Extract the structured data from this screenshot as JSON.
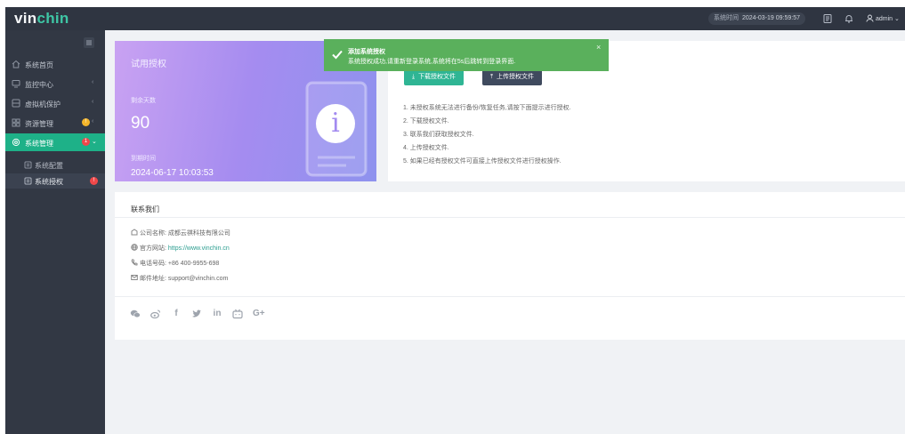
{
  "app": {
    "logo_prefix": "vin",
    "logo_suffix": "chin",
    "system_time_label": "系统时间",
    "system_time_value": "2024-03-19 09:59:57",
    "user_name": "admin"
  },
  "colors": {
    "topbar": "#2f3541",
    "sidebar": "#323844",
    "accent": "#1eb188",
    "toast": "#5ab05c",
    "badge_red": "#f0484a",
    "badge_yellow": "#f3b52b"
  },
  "sidebar": {
    "items": [
      {
        "label": "系统首页",
        "icon": "home-icon"
      },
      {
        "label": "监控中心",
        "icon": "monitor-icon"
      },
      {
        "label": "虚拟机保护",
        "icon": "server-icon"
      },
      {
        "label": "资源管理",
        "icon": "grid-icon",
        "badge": "!"
      },
      {
        "label": "系统管理",
        "icon": "gear-icon",
        "badge": "1"
      }
    ],
    "subitems": [
      {
        "label": "系统配置",
        "icon": "config-icon"
      },
      {
        "label": "系统授权",
        "icon": "license-icon",
        "badge": "!"
      }
    ]
  },
  "trial": {
    "title": "试用授权",
    "remaining_label": "剩余天数",
    "remaining_days": "90",
    "expiry_label": "到期时间",
    "expiry_value": "2024-06-17 10:03:53"
  },
  "actions": {
    "download_label": "下载授权文件",
    "upload_label": "上传授权文件",
    "steps": [
      "1. 未授权系统无法进行备份/恢复任务,请按下面提示进行授权.",
      "2. 下载授权文件.",
      "3. 联系我们获取授权文件.",
      "4. 上传授权文件.",
      "5. 如果已经有授权文件可直接上传授权文件进行授权操作."
    ]
  },
  "contact": {
    "title": "联系我们",
    "company_label": "公司名称:",
    "company_value": "成都云祺科技有限公司",
    "website_label": "官方网站:",
    "website_value": "https://www.vinchin.cn",
    "phone_label": "电话号码:",
    "phone_value": "+86 400-9955-698",
    "email_label": "邮件地址:",
    "email_value": "support@vinchin.com",
    "social": [
      {
        "icon": "wechat-icon",
        "glyph": ""
      },
      {
        "icon": "weibo-icon",
        "glyph": ""
      },
      {
        "icon": "facebook-icon",
        "glyph": "f"
      },
      {
        "icon": "twitter-icon",
        "glyph": ""
      },
      {
        "icon": "linkedin-icon",
        "glyph": "in"
      },
      {
        "icon": "bilibili-icon",
        "glyph": ""
      },
      {
        "icon": "google-plus-icon",
        "glyph": "G+"
      }
    ]
  },
  "toast": {
    "title": "添加系统授权",
    "message": "系统授权成功,请重新登录系统,系统将在5s后跳转到登录界面.",
    "close": "×"
  }
}
